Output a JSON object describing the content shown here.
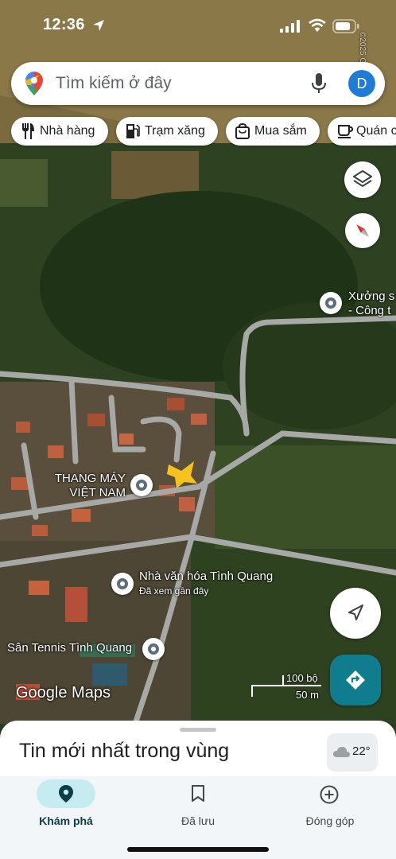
{
  "status": {
    "time": "12:36"
  },
  "search": {
    "placeholder": "Tìm kiếm ở đây",
    "avatar_letter": "D"
  },
  "chips": [
    {
      "label": "Nhà hàng",
      "icon": "restaurant-icon"
    },
    {
      "label": "Trạm xăng",
      "icon": "gas-station-icon"
    },
    {
      "label": "Mua sắm",
      "icon": "shopping-bag-icon"
    },
    {
      "label": "Quán c",
      "icon": "coffee-icon"
    }
  ],
  "map": {
    "places": [
      {
        "name": "Xưởng s",
        "sub": "- Công t"
      },
      {
        "name": "THANG MÁY",
        "sub": "VIỆT NAM"
      },
      {
        "name": "Nhà văn hóa Tình Quang",
        "sub": "Đã xem gần đây"
      },
      {
        "name": "Sân Tennis Tình Quang"
      }
    ],
    "watermark": "Google Maps",
    "scale": {
      "imperial": "100 bộ",
      "metric": "50 m"
    },
    "copyright": "©2025 Google"
  },
  "sheet": {
    "title": "Tin mới nhất trong vùng",
    "weather": "22°"
  },
  "nav": [
    {
      "label": "Khám phá",
      "active": true
    },
    {
      "label": "Đã lưu",
      "active": false
    },
    {
      "label": "Đóng góp",
      "active": false
    }
  ]
}
